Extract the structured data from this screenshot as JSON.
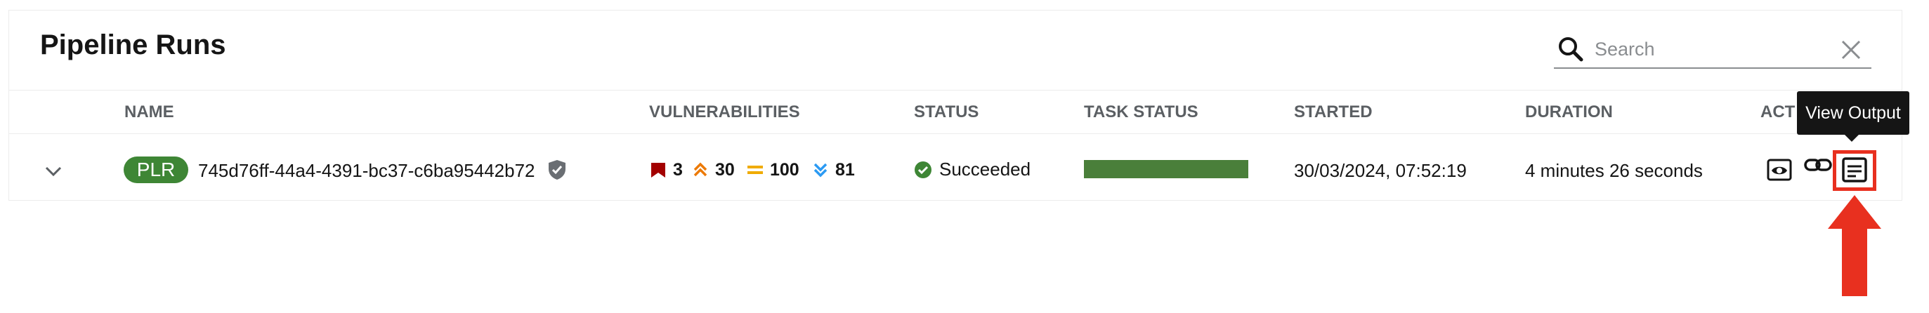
{
  "page": {
    "title": "Pipeline Runs"
  },
  "search": {
    "placeholder": "Search",
    "value": ""
  },
  "table": {
    "headers": {
      "name": "NAME",
      "vulnerabilities": "VULNERABILITIES",
      "status": "STATUS",
      "task_status": "TASK STATUS",
      "started": "STARTED",
      "duration": "DURATION",
      "actions": "ACT"
    },
    "rows": [
      {
        "badge": "PLR",
        "name": "745d76ff-44a4-4391-bc37-c6ba95442b72",
        "vulnerabilities": {
          "critical": "3",
          "high": "30",
          "medium": "100",
          "low": "81"
        },
        "status": "Succeeded",
        "task_status_progress": 1.0,
        "started": "30/03/2024, 07:52:19",
        "duration": "4 minutes 26 seconds"
      }
    ]
  },
  "tooltip": {
    "text": "View Output"
  },
  "colors": {
    "badge_green": "#3e8635",
    "critical": "#a30000",
    "high": "#ec7a08",
    "medium": "#f0ab00",
    "low": "#2b9af3",
    "success": "#3e8635",
    "task_bar": "#4a7f3a",
    "highlight": "#e8301f"
  },
  "icons": {
    "search": "search-icon",
    "clear": "close-icon",
    "expand": "chevron-down-icon",
    "signed": "shield-icon",
    "critical": "critical-severity-icon",
    "high": "high-severity-icon",
    "medium": "medium-severity-icon",
    "low": "low-severity-icon",
    "status": "check-circle-icon",
    "view_logs": "eye-icon",
    "copy_link": "link-icon",
    "view_output": "output-icon"
  }
}
